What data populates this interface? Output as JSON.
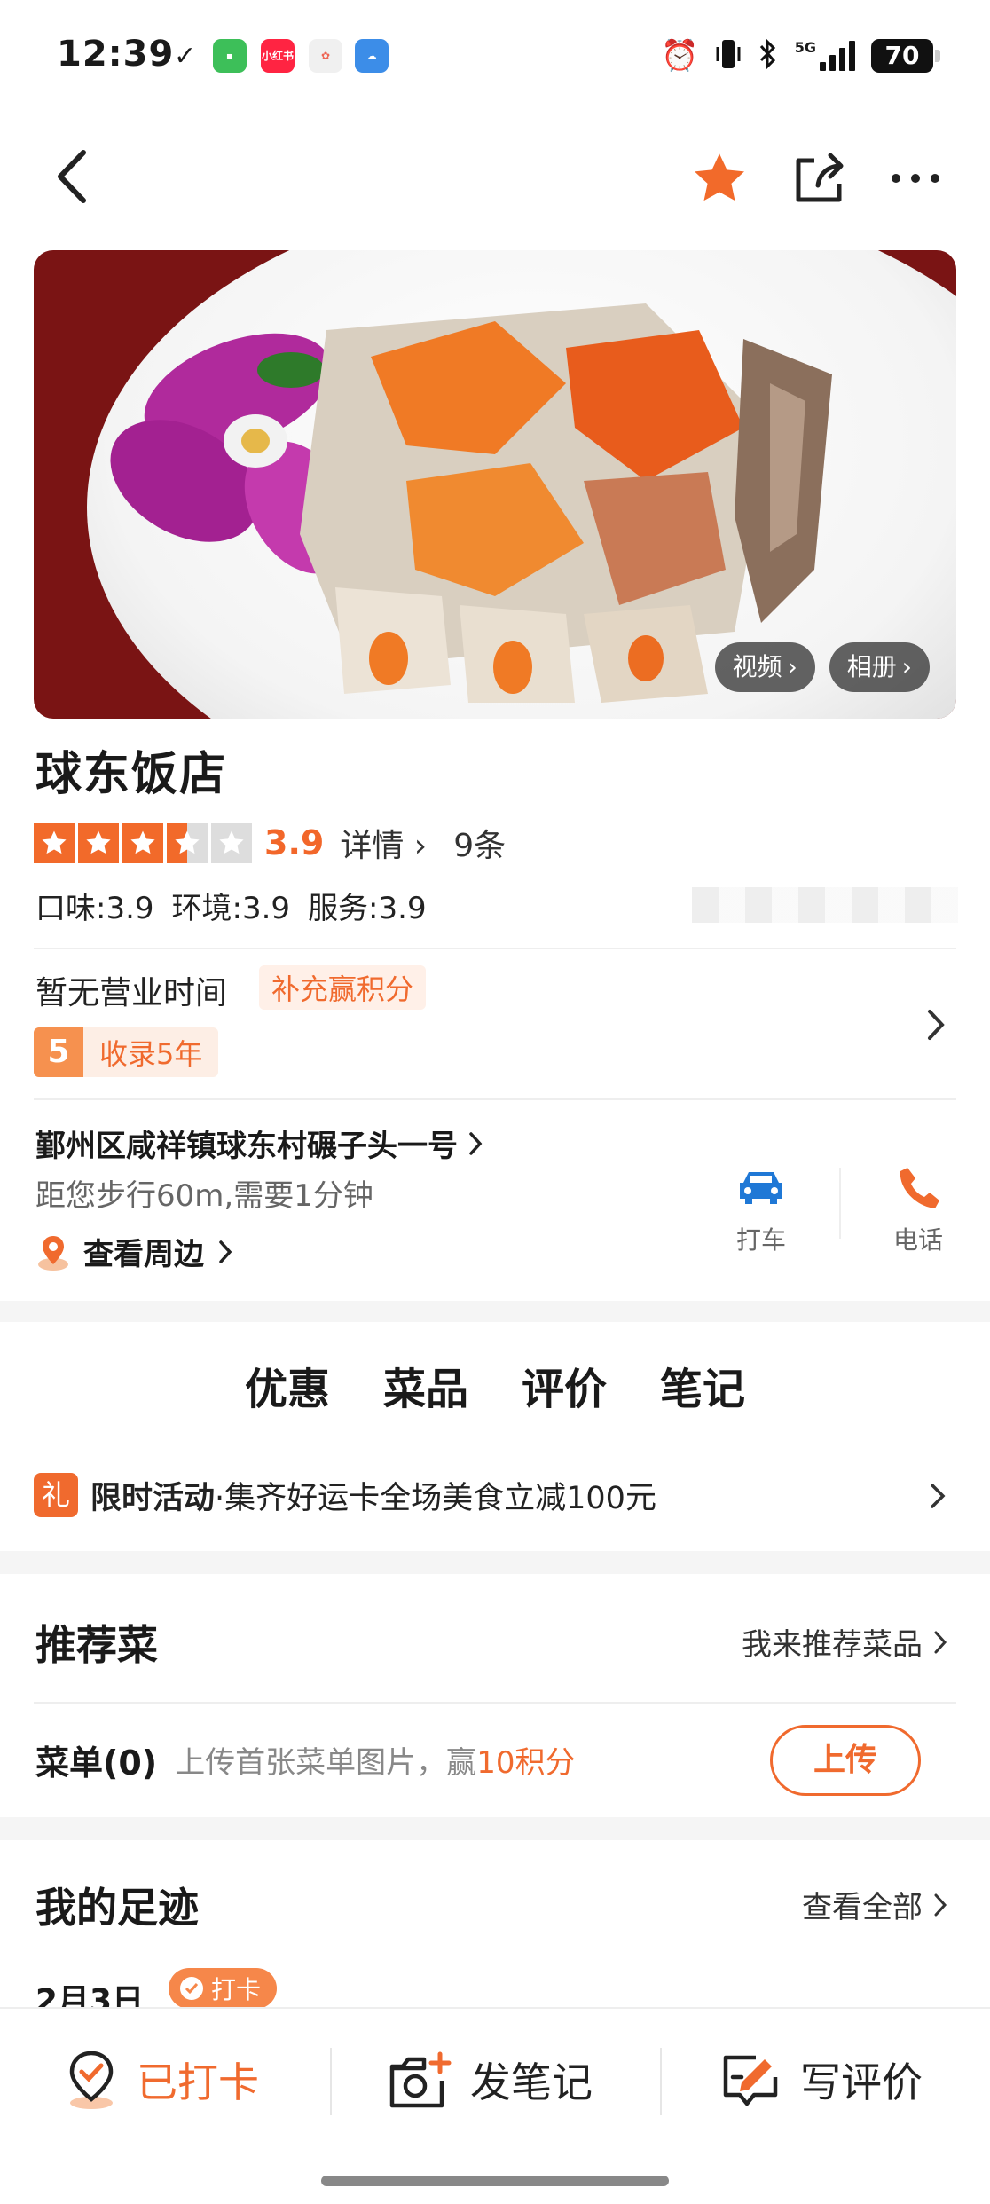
{
  "status_bar": {
    "time": "12:39",
    "check": "✓",
    "app_icon_text": "小红书",
    "battery": "70",
    "network": "5G"
  },
  "nav": {
    "back_icon": "back-arrow-icon",
    "favorite_icon": "star-icon",
    "share_icon": "share-icon",
    "more_icon": "more-icon"
  },
  "hero": {
    "video_label": "视频",
    "album_label": "相册"
  },
  "shop": {
    "name": "球东饭店",
    "rating": "3.9",
    "rating_value": 3.5,
    "details_label": "详情",
    "review_count": "9条",
    "taste": "口味:3.9",
    "environment": "环境:3.9",
    "service": "服务:3.9",
    "hours": "暂无营业时间",
    "hours_bonus": "补充赢积分",
    "years_num": "5",
    "years_label": "收录5年",
    "address": "鄞州区咸祥镇球东村碾子头一号",
    "distance": "距您步行60m,需要1分钟",
    "nearby": "查看周边",
    "taxi_label": "打车",
    "phone_label": "电话"
  },
  "tabs": [
    {
      "label": "优惠"
    },
    {
      "label": "菜品"
    },
    {
      "label": "评价"
    },
    {
      "label": "笔记"
    }
  ],
  "promo": {
    "badge": "礼",
    "title": "限时活动",
    "text": "·集齐好运卡全场美食立减100元"
  },
  "recommend": {
    "title": "推荐菜",
    "link": "我来推荐菜品",
    "menu_label": "菜单(0)",
    "menu_hint_prefix": "上传首张菜单图片，赢",
    "menu_hint_points": "10积分",
    "upload_label": "上传"
  },
  "footprint": {
    "title": "我的足迹",
    "link": "查看全部",
    "date": "2月3日",
    "badge": "打卡"
  },
  "bottom_bar": {
    "checked_in": "已打卡",
    "post_note": "发笔记",
    "write_review": "写评价"
  },
  "colors": {
    "accent": "#f06a2e",
    "star": "#f26a2a",
    "score": "#f2672a"
  }
}
